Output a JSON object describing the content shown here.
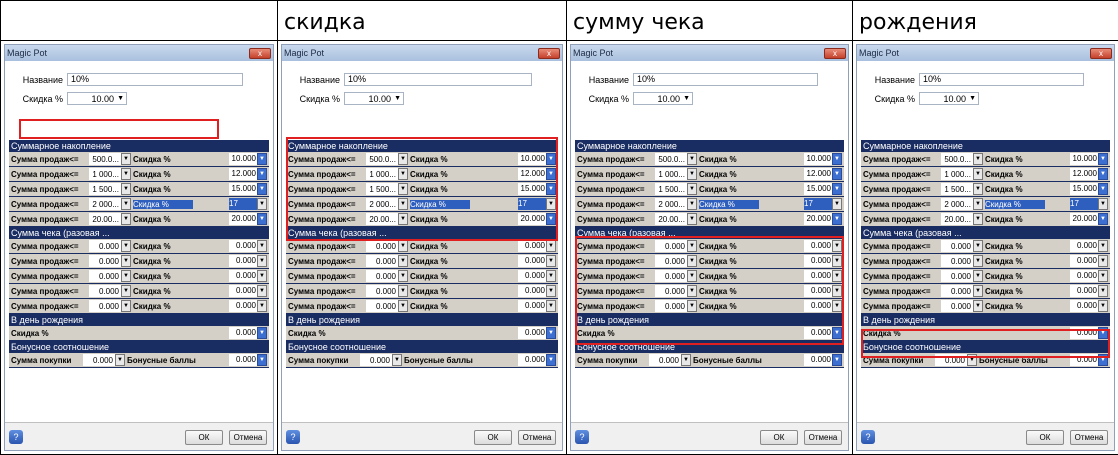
{
  "headers": [
    "",
    "скидка",
    "сумму чека",
    "рождения"
  ],
  "dialog": {
    "title": "Magic Pot",
    "close_label": "x",
    "name_label": "Название",
    "name_value": "10%",
    "discount_label": "Скидка %",
    "discount_value": "10.00",
    "section_accum": "Суммарное накопление",
    "accum_rows": [
      {
        "label": "Сумма продаж<=",
        "v1": "500.0...",
        "label2": "Скидка %",
        "v2": "10.000"
      },
      {
        "label": "Сумма продаж<=",
        "v1": "1 000...",
        "label2": "Скидка %",
        "v2": "12.000"
      },
      {
        "label": "Сумма продаж<=",
        "v1": "1 500...",
        "label2": "Скидка %",
        "v2": "15.000"
      },
      {
        "label": "Сумма продаж<=",
        "v1": "2 000...",
        "label2": "Скидка %",
        "v2": "17"
      },
      {
        "label": "Сумма продаж<=",
        "v1": "20.00...",
        "label2": "Скидка %",
        "v2": "20.000"
      }
    ],
    "section_check": "Сумма чека (разовая ...",
    "check_rows": [
      {
        "label": "Сумма продаж<=",
        "v1": "0.000",
        "label2": "Скидка %",
        "v2": "0.000"
      },
      {
        "label": "Сумма продаж<=",
        "v1": "0.000",
        "label2": "Скидка %",
        "v2": "0.000"
      },
      {
        "label": "Сумма продаж<=",
        "v1": "0.000",
        "label2": "Скидка %",
        "v2": "0.000"
      },
      {
        "label": "Сумма продаж<=",
        "v1": "0.000",
        "label2": "Скидка %",
        "v2": "0.000"
      },
      {
        "label": "Сумма продаж<=",
        "v1": "0.000",
        "label2": "Скидка %",
        "v2": "0.000"
      }
    ],
    "section_birthday": "В день рождения",
    "birthday_label": "Скидка %",
    "birthday_value": "0.000",
    "section_bonus": "Бонусное соотношение",
    "bonus_label": "Сумма покупки",
    "bonus_v1": "0.000",
    "bonus_label2": "Бонусные баллы",
    "bonus_v2": "0.000",
    "help_label": "?",
    "ok_label": "ОК",
    "cancel_label": "Отмена"
  },
  "colors": {
    "highlight": "#e02020",
    "panel": "#1a2d63"
  }
}
